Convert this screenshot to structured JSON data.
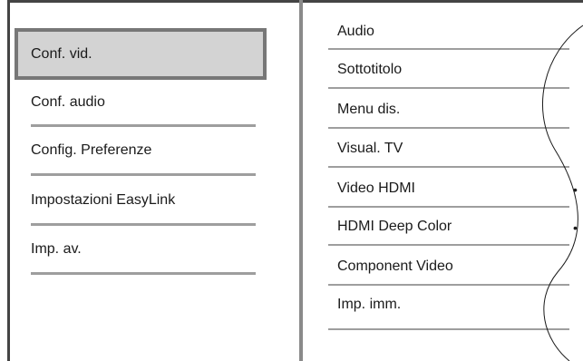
{
  "left_menu": {
    "items": [
      {
        "label": "Conf. vid."
      },
      {
        "label": "Conf. audio"
      },
      {
        "label": "Config. Preferenze"
      },
      {
        "label": "Impostazioni EasyLink"
      },
      {
        "label": "Imp. av."
      }
    ],
    "selected_index": 0
  },
  "right_menu": {
    "items": [
      {
        "label": "Audio"
      },
      {
        "label": "Sottotitolo"
      },
      {
        "label": "Menu dis."
      },
      {
        "label": "Visual. TV"
      },
      {
        "label": "Video HDMI",
        "marker": "•"
      },
      {
        "label": "HDMI Deep Color",
        "marker": "•"
      },
      {
        "label": "Component Video"
      },
      {
        "label": "Imp. imm."
      }
    ]
  },
  "colors": {
    "selected_background": "#d3d3d3",
    "selected_border": "#777777",
    "rule": "#9e9e9e",
    "divider": "#8a8a8a"
  }
}
